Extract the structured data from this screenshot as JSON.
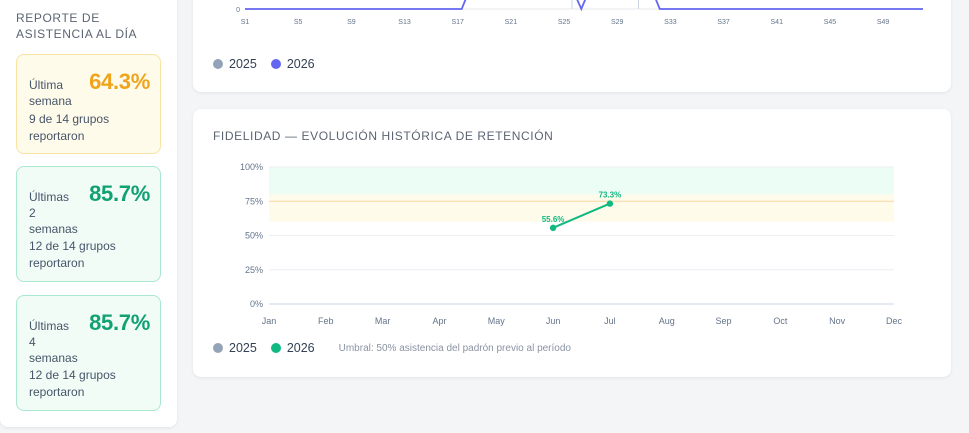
{
  "sidebar": {
    "title": "REPORTE DE ASISTENCIA AL DÍA",
    "cards": [
      {
        "label": "Última semana",
        "value": "64.3%",
        "groups": "9 de 14 grupos reportaron"
      },
      {
        "label": "Últimas 2 semanas",
        "value": "85.7%",
        "groups": "12 de 14 grupos reportaron"
      },
      {
        "label": "Últimas 4 semanas",
        "value": "85.7%",
        "groups": "12 de 14 grupos reportaron"
      }
    ]
  },
  "weekly_panel": {
    "legend": [
      {
        "label": "2025",
        "color": "#94a3b8"
      },
      {
        "label": "2026",
        "color": "#6366f1"
      }
    ]
  },
  "retention_panel": {
    "title": "FIDELIDAD — EVOLUCIÓN HISTÓRICA DE RETENCIÓN",
    "legend": [
      {
        "label": "2025",
        "color": "#94a3b8"
      },
      {
        "label": "2026",
        "color": "#10b981"
      }
    ],
    "note": "Umbral: 50% asistencia del padrón previo al período"
  },
  "chart_data": [
    {
      "type": "line",
      "x_ticks": [
        "S1",
        "S5",
        "S9",
        "S13",
        "S17",
        "S21",
        "S25",
        "S29",
        "S33",
        "S37",
        "S41",
        "S45",
        "S49"
      ],
      "y_ticks": [
        "0"
      ],
      "series": [
        {
          "name": "2025",
          "color": "#94a3b8"
        },
        {
          "name": "2026",
          "color": "#6366f1"
        }
      ]
    },
    {
      "type": "line",
      "categories": [
        "Jan",
        "Feb",
        "Mar",
        "Apr",
        "May",
        "Jun",
        "Jul",
        "Aug",
        "Sep",
        "Oct",
        "Nov",
        "Dec"
      ],
      "y_ticks": [
        "0%",
        "25%",
        "50%",
        "75%",
        "100%"
      ],
      "ylim": [
        0,
        100
      ],
      "bands": [
        {
          "from": 80,
          "to": 100,
          "color": "#ecfdf5"
        },
        {
          "from": 60,
          "to": 80,
          "color": "#fffbeb"
        }
      ],
      "series": [
        {
          "name": "2026",
          "color": "#10b981",
          "x": [
            "Jun",
            "Jul"
          ],
          "values": [
            55.6,
            73.3
          ],
          "labels": [
            "55.6%",
            "73.3%"
          ]
        }
      ]
    }
  ]
}
